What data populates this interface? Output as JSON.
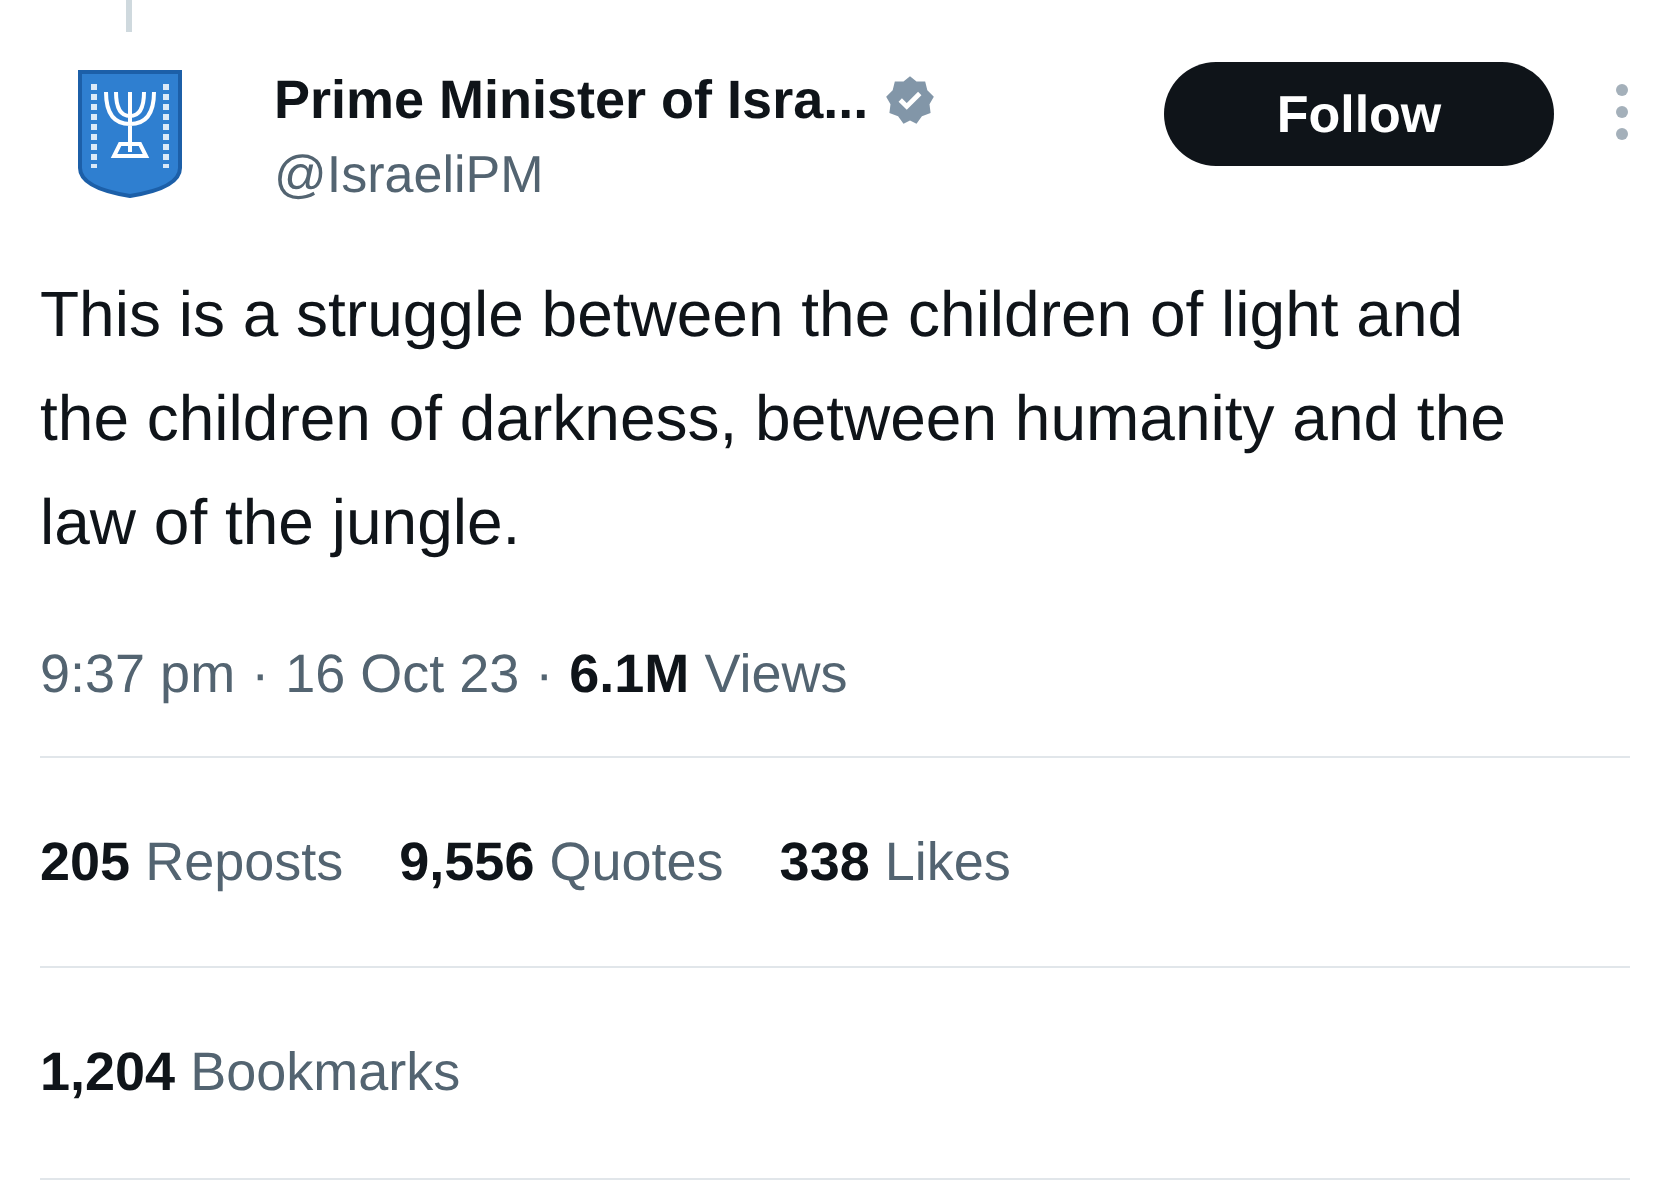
{
  "author": {
    "name": "Prime Minister of Isra...",
    "handle": "@IsraeliPM"
  },
  "follow_button": "Follow",
  "text": "This is a struggle between the children of light and the children of darkness, between humanity and the law of the jungle.",
  "meta": {
    "time": "9:37 pm",
    "separator_1": "·",
    "date": "16 Oct 23",
    "separator_2": "·",
    "views_count": "6.1M",
    "views_label": "Views"
  },
  "engagement": [
    {
      "count": "205",
      "label": "Reposts"
    },
    {
      "count": "9,556",
      "label": "Quotes"
    },
    {
      "count": "338",
      "label": "Likes"
    }
  ],
  "bookmarks": {
    "count": "1,204",
    "label": "Bookmarks"
  }
}
